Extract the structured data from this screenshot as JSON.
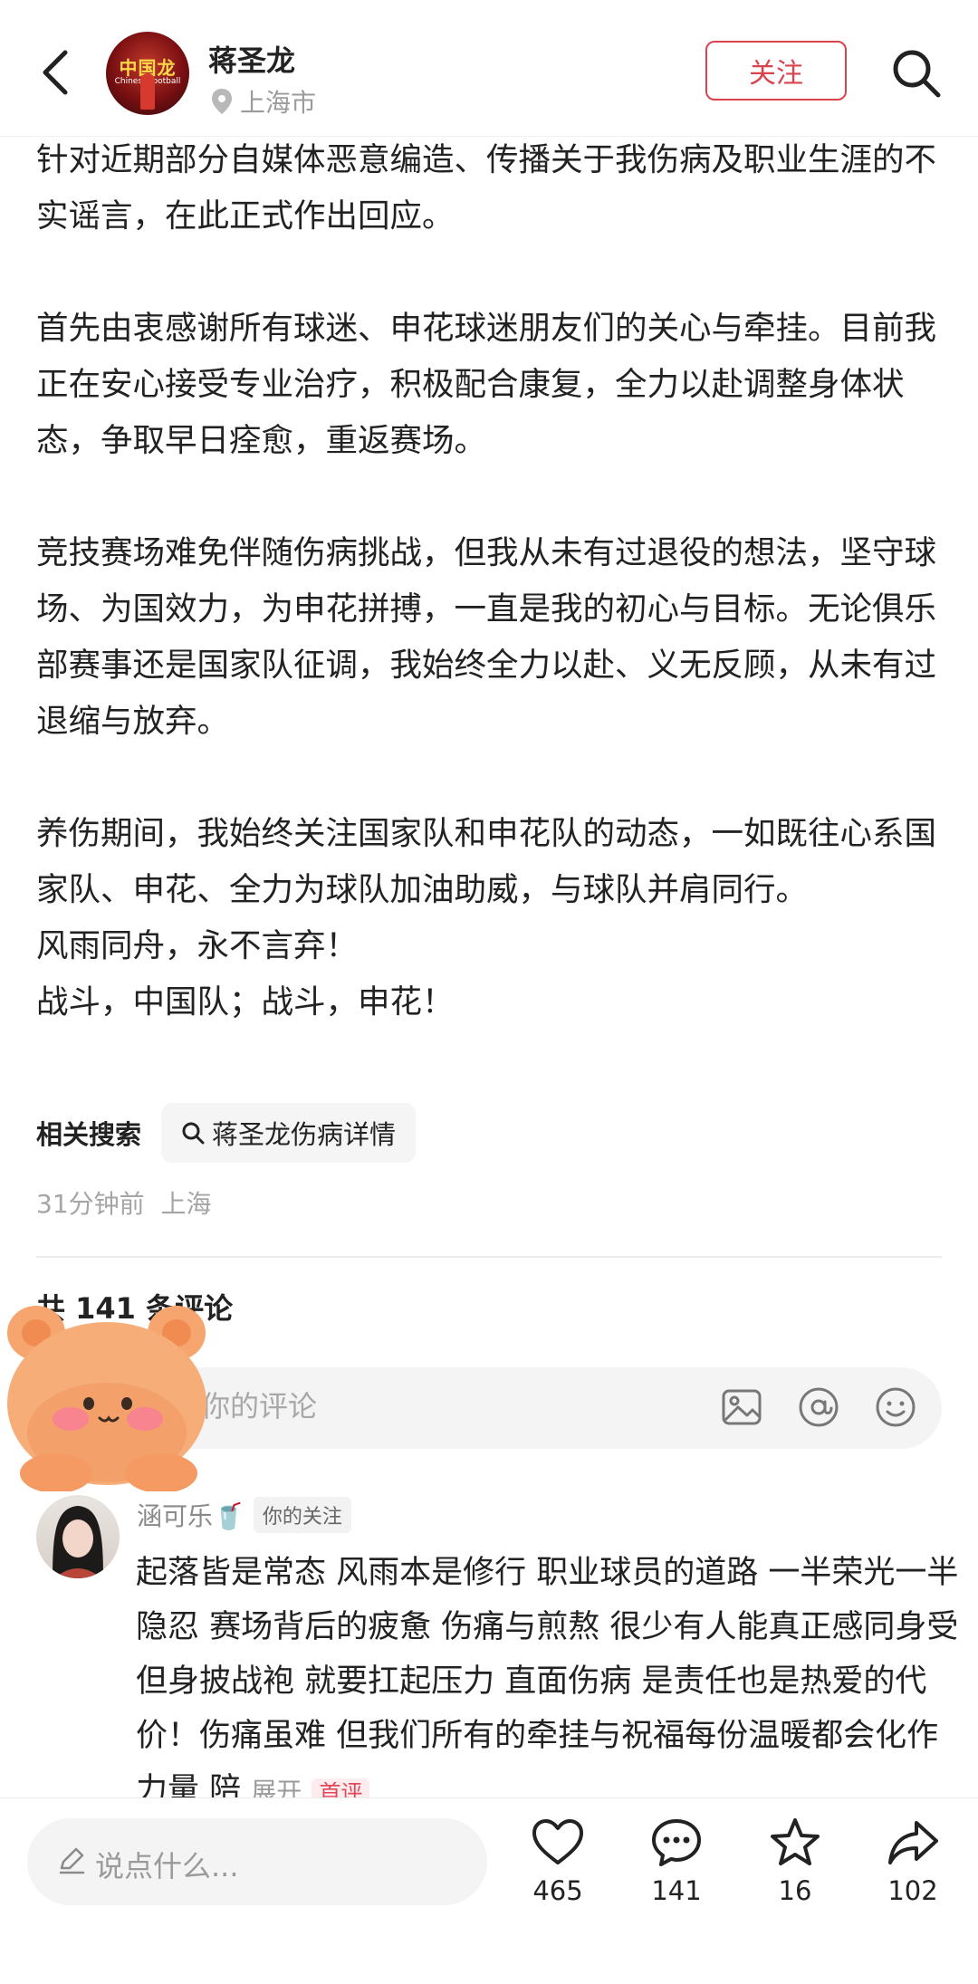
{
  "header": {
    "author_name": "蒋圣龙",
    "location": "上海市",
    "avatar_title": "中国龙",
    "avatar_subtitle": "Chinese football",
    "follow_label": "关注"
  },
  "post": {
    "paragraphs": [
      "针对近期部分自媒体恶意编造、传播关于我伤病及职业生涯的不实谣言，在此正式作出回应。",
      "首先由衷感谢所有球迷、申花球迷朋友们的关心与牵挂。目前我正在安心接受专业治疗，积极配合康复，全力以赴调整身体状态，争取早日痊愈，重返赛场。",
      "竞技赛场难免伴随伤病挑战，但我从未有过退役的想法，坚守球场、为国效力，为申花拼搏，一直是我的初心与目标。无论俱乐部赛事还是国家队征调，我始终全力以赴、义无反顾，从未有过退缩与放弃。",
      "养伤期间，我始终关注国家队和申花队的动态，一如既往心系国家队、申花、全力为球队加油助威，与球队并肩同行。",
      "风雨同舟，永不言弃！",
      "战斗，中国队；战斗，申花！"
    ],
    "related_label": "相关搜索",
    "related_query": "蒋圣龙伤病详情",
    "time": "31分钟前",
    "place": "上海"
  },
  "comments": {
    "title": "共 141 条评论",
    "placeholder": "待你的评论",
    "items": [
      {
        "user": "涵可乐🥤",
        "badge": "你的关注",
        "text": "起落皆是常态 风雨本是修行 职业球员的道路 一半荣光一半隐忍 赛场背后的疲惫 伤痛与煎熬 很少有人能真正感同身受 但身披战袍 就要扛起压力 直面伤病 是责任也是热爱的代价！伤痛虽难 但我们所有的牵挂与祝福每份温暖都会化作力量 陪",
        "expand": "展开",
        "tag": "首评"
      }
    ]
  },
  "bottom": {
    "input_placeholder": "说点什么...",
    "likes": "465",
    "comments": "141",
    "favorites": "16",
    "shares": "102"
  },
  "colors": {
    "accent": "#d9434e",
    "muted": "#a5a5a5"
  }
}
